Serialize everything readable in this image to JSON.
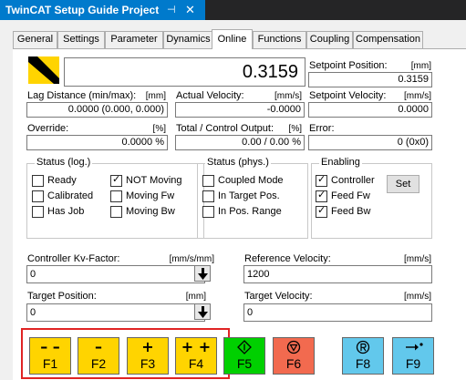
{
  "window": {
    "title": "TwinCAT Setup Guide Project",
    "pin_glyph": "⊣",
    "close_glyph": "✕"
  },
  "tabs": [
    "General",
    "Settings",
    "Parameter",
    "Dynamics",
    "Online",
    "Functions",
    "Coupling",
    "Compensation"
  ],
  "active_tab": "Online",
  "online": {
    "position_value": "0.3159",
    "setpoint_position": {
      "label": "Setpoint Position:",
      "unit": "[mm]",
      "value": "0.3159"
    },
    "lag_distance": {
      "label": "Lag Distance (min/max):",
      "unit": "[mm]",
      "value": "0.0000  (0.000, 0.000)"
    },
    "actual_velocity": {
      "label": "Actual Velocity:",
      "unit": "[mm/s]",
      "value": "-0.0000"
    },
    "setpoint_velocity": {
      "label": "Setpoint Velocity:",
      "unit": "[mm/s]",
      "value": "0.0000"
    },
    "override": {
      "label": "Override:",
      "unit": "[%]",
      "value": "0.0000 %"
    },
    "total_output": {
      "label": "Total / Control Output:",
      "unit": "[%]",
      "value": "0.00 /  0.00 %"
    },
    "error": {
      "label": "Error:",
      "value": "0 (0x0)"
    }
  },
  "status_log": {
    "title": "Status (log.)",
    "items": [
      {
        "label": "Ready",
        "checked": false
      },
      {
        "label": "Calibrated",
        "checked": false
      },
      {
        "label": "Has Job",
        "checked": false
      },
      {
        "label": "NOT Moving",
        "checked": true
      },
      {
        "label": "Moving Fw",
        "checked": false
      },
      {
        "label": "Moving Bw",
        "checked": false
      }
    ]
  },
  "status_phys": {
    "title": "Status (phys.)",
    "items": [
      {
        "label": "Coupled Mode",
        "checked": false
      },
      {
        "label": "In Target Pos.",
        "checked": false
      },
      {
        "label": "In Pos. Range",
        "checked": false
      }
    ]
  },
  "enabling": {
    "title": "Enabling",
    "items": [
      {
        "label": "Controller",
        "checked": true
      },
      {
        "label": "Feed Fw",
        "checked": true
      },
      {
        "label": "Feed Bw",
        "checked": true
      }
    ],
    "set_label": "Set"
  },
  "controller_kv": {
    "label": "Controller Kv-Factor:",
    "unit": "[mm/s/mm]",
    "value": "0"
  },
  "reference_velocity": {
    "label": "Reference Velocity:",
    "unit": "[mm/s]",
    "value": "1200"
  },
  "target_position": {
    "label": "Target Position:",
    "unit": "[mm]",
    "value": "0"
  },
  "target_velocity": {
    "label": "Target Velocity:",
    "unit": "[mm/s]",
    "value": "0"
  },
  "function_keys": [
    {
      "key": "F1",
      "symbol": "– –",
      "color": "#ffd400"
    },
    {
      "key": "F2",
      "symbol": "–",
      "color": "#ffd400"
    },
    {
      "key": "F3",
      "symbol": "+",
      "color": "#ffd400"
    },
    {
      "key": "F4",
      "symbol": "+ +",
      "color": "#ffd400"
    },
    {
      "key": "F5",
      "icon": "diamond-start-icon",
      "color": "#00d000"
    },
    {
      "key": "F6",
      "icon": "stop-triangle-icon",
      "color": "#f26a4f"
    },
    {
      "key": "F8",
      "icon": "reset-r-icon",
      "color": "#62c8ec"
    },
    {
      "key": "F9",
      "icon": "arrow-to-target-icon",
      "color": "#62c8ec"
    }
  ],
  "colors": {
    "accent": "#007acc",
    "highlight_border": "#e02424"
  }
}
